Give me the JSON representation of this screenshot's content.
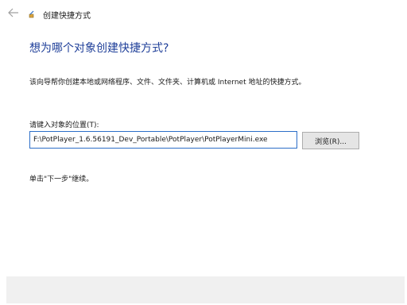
{
  "window": {
    "title": "创建快捷方式",
    "back_icon": "arrow-left-icon",
    "app_icon": "shortcut-wizard-icon"
  },
  "main": {
    "heading": "想为哪个对象创建快捷方式?",
    "description": "该向导帮你创建本地或网络程序、文件、文件夹、计算机或 Internet 地址的快捷方式。",
    "location_label": "请键入对象的位置(T):",
    "location_value": "F:\\PotPlayer_1.6.56191_Dev_Portable\\PotPlayer\\PotPlayerMini.exe",
    "browse_label": "浏览(R)...",
    "hint": "单击\"下一步\"继续。"
  },
  "colors": {
    "heading": "#1f3f99",
    "input_border": "#2c6ec8",
    "button_bg": "#e5e5e5",
    "footer_bg": "#f0f0f0"
  }
}
